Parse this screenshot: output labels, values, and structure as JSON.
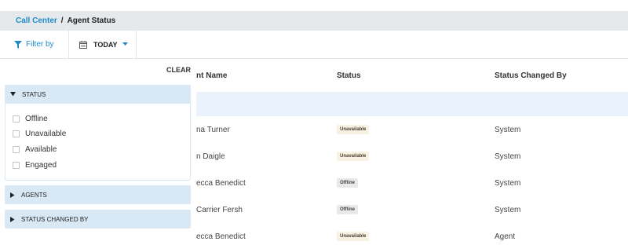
{
  "breadcrumb": {
    "parent": "Call Center",
    "separator": "/",
    "current": "Agent Status"
  },
  "toolbar": {
    "filter_label": "Filter by",
    "date_label": "TODAY"
  },
  "table": {
    "headers": {
      "name": "nt Name",
      "status": "Status",
      "changed_by": "Status Changed By"
    },
    "rows": [
      {
        "name": "na Turner",
        "status": "Unavailable",
        "status_kind": "unavailable",
        "changed_by": "System"
      },
      {
        "name": "n Daigle",
        "status": "Unavailable",
        "status_kind": "unavailable",
        "changed_by": "System"
      },
      {
        "name": "ecca Benedict",
        "status": "Offline",
        "status_kind": "offline",
        "changed_by": "System"
      },
      {
        "name": "Carrier Fersh",
        "status": "Offline",
        "status_kind": "offline",
        "changed_by": "System"
      },
      {
        "name": "ecca Benedict",
        "status": "Unavailable",
        "status_kind": "unavailable",
        "changed_by": "Agent"
      }
    ]
  },
  "filter_panel": {
    "clear_label": "CLEAR",
    "status_section": {
      "title": "STATUS",
      "expanded": true,
      "options": [
        {
          "label": "Offline",
          "checked": false
        },
        {
          "label": "Unavailable",
          "checked": false
        },
        {
          "label": "Available",
          "checked": false
        },
        {
          "label": "Engaged",
          "checked": false
        }
      ]
    },
    "agents_section": {
      "title": "AGENTS",
      "expanded": false
    },
    "changed_by_section": {
      "title": "STATUS CHANGED BY",
      "expanded": false
    }
  },
  "colors": {
    "accent": "#1f8ac9",
    "header_bar": "#e6e9ec",
    "section_header": "#d9e8f5",
    "group_row": "#eaf3fb"
  },
  "icons": {
    "filter": "funnel-icon",
    "date": "calendar-icon",
    "date_menu": "caret-down-icon",
    "expanded": "triangle-down-icon",
    "collapsed": "triangle-right-icon"
  }
}
